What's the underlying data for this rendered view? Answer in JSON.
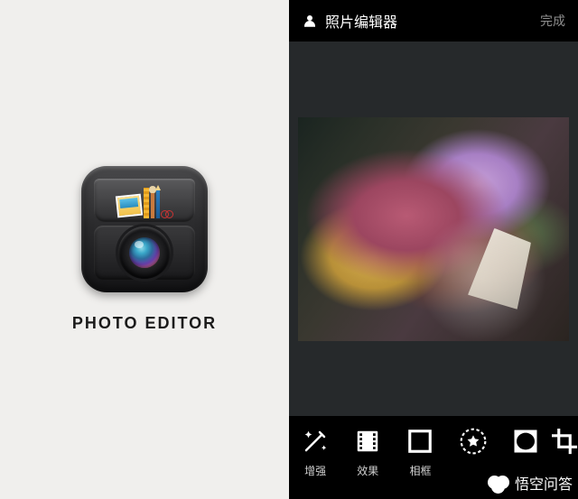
{
  "left": {
    "app_name": "PHOTO EDITOR"
  },
  "editor": {
    "header": {
      "title": "照片编辑器",
      "done_label": "完成"
    },
    "tools": [
      {
        "id": "enhance",
        "label": "增强"
      },
      {
        "id": "effects",
        "label": "效果"
      },
      {
        "id": "frame",
        "label": "相框"
      }
    ]
  },
  "watermark": {
    "text": "悟空问答"
  }
}
